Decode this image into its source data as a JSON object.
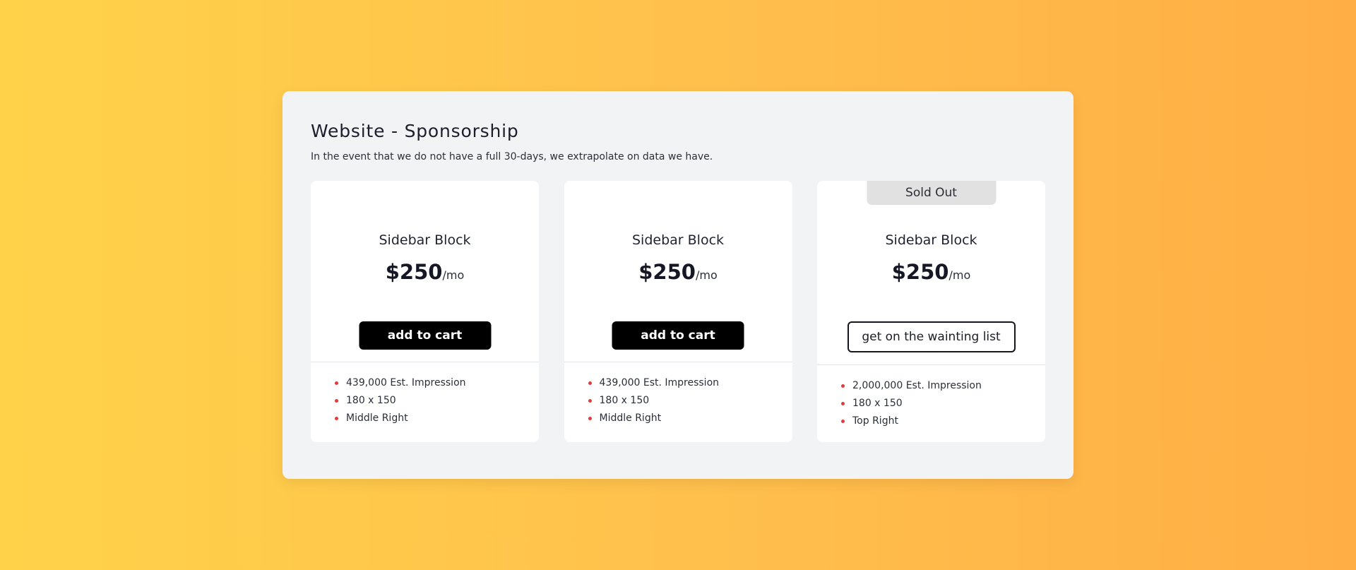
{
  "page": {
    "title": "Website - Sponsorship",
    "subtitle": "In the event that we do not have a full 30-days, we extrapolate on data we have."
  },
  "colors": {
    "background_start": "#ffd24a",
    "background_end": "#ffae45",
    "bullet": "#e23b3b",
    "primary_button": "#000000"
  },
  "cards": [
    {
      "name": "Sidebar Block",
      "price": "$250",
      "period": "/mo",
      "button": "add to cart",
      "features": [
        "439,000 Est. Impression",
        "180 x 150",
        "Middle Right"
      ]
    },
    {
      "name": "Sidebar Block",
      "price": "$250",
      "period": "/mo",
      "button": "add to cart",
      "features": [
        "439,000 Est. Impression",
        "180 x 150",
        "Middle Right"
      ]
    },
    {
      "badge": "Sold Out",
      "name": "Sidebar Block",
      "price": "$250",
      "period": "/mo",
      "button": "get on the wainting list",
      "features": [
        "2,000,000 Est. Impression",
        "180 x 150",
        "Top Right"
      ]
    }
  ]
}
